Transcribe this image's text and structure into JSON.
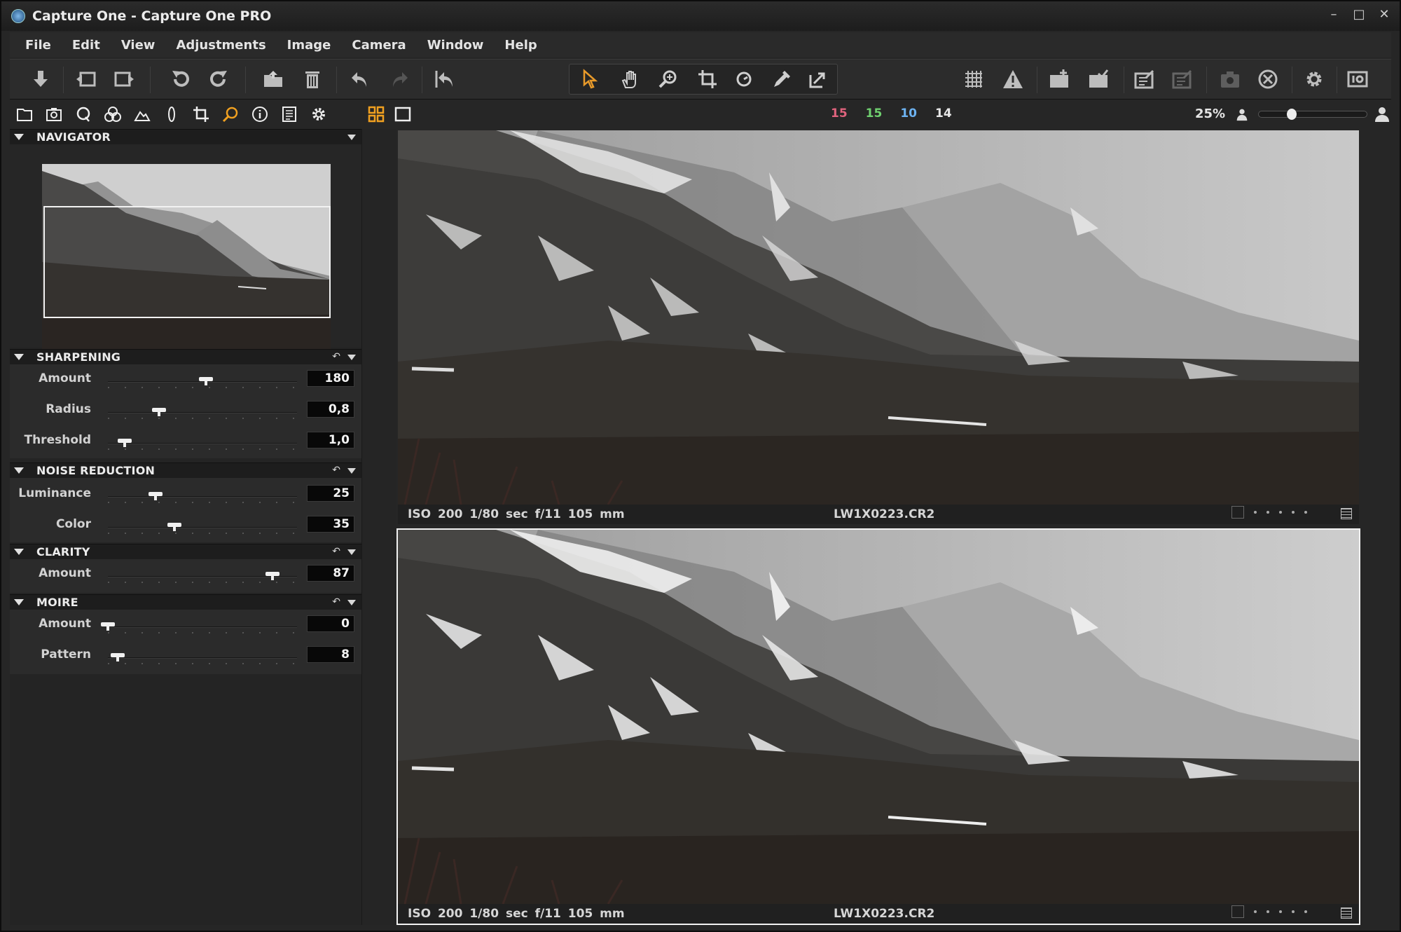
{
  "window": {
    "title": "Capture One - Capture One PRO"
  },
  "menu": [
    "File",
    "Edit",
    "View",
    "Adjustments",
    "Image",
    "Camera",
    "Window",
    "Help"
  ],
  "toolbar": {
    "left": [
      "import-icon",
      "move-left-icon",
      "move-right-icon",
      "rotate-left-icon",
      "rotate-right-icon",
      "open-folder-icon",
      "trash-icon",
      "undo-icon",
      "redo-icon",
      "reset-icon"
    ],
    "cursor_tools": [
      "select-cursor-icon",
      "pan-hand-icon",
      "zoom-icon",
      "crop-icon",
      "rotate-tool-icon",
      "picker-icon",
      "copy-apply-icon"
    ],
    "right": [
      "grid-icon",
      "exposure-warning-icon",
      "new-variant-icon",
      "clone-variant-icon",
      "process-icon",
      "batch-icon",
      "camera-icon",
      "cancel-icon",
      "preferences-icon",
      "info-icon"
    ]
  },
  "tool_tabs": [
    "library-icon",
    "capture-icon",
    "quick-icon",
    "color-icon",
    "exposure-icon",
    "lens-icon",
    "composition-icon",
    "details-icon",
    "metadata-icon",
    "output-icon",
    "settings-icon"
  ],
  "viewer_header": {
    "counts": [
      {
        "value": "15",
        "color": "#e0637d"
      },
      {
        "value": "15",
        "color": "#6fd06f"
      },
      {
        "value": "10",
        "color": "#6db3f2"
      },
      {
        "value": "14",
        "color": "#e8e8e8"
      }
    ],
    "zoom": "25%"
  },
  "navigator": {
    "title": "NAVIGATOR"
  },
  "sharpening": {
    "title": "SHARPENING",
    "rows": [
      {
        "label": "Amount",
        "value": "180",
        "level": 0.52
      },
      {
        "label": "Radius",
        "value": "0,8",
        "level": 0.27
      },
      {
        "label": "Threshold",
        "value": "1,0",
        "level": 0.09
      }
    ]
  },
  "noise_reduction": {
    "title": "NOISE REDUCTION",
    "rows": [
      {
        "label": "Luminance",
        "value": "25",
        "level": 0.25
      },
      {
        "label": "Color",
        "value": "35",
        "level": 0.35
      }
    ]
  },
  "clarity": {
    "title": "CLARITY",
    "rows": [
      {
        "label": "Amount",
        "value": "87",
        "level": 0.87
      }
    ]
  },
  "moire": {
    "title": "MOIRE",
    "rows": [
      {
        "label": "Amount",
        "value": "0",
        "level": 0.0
      },
      {
        "label": "Pattern",
        "value": "8",
        "level": 0.05
      }
    ]
  },
  "images": [
    {
      "meta": "ISO 200  1/80 sec  f/11  105 mm",
      "filename": "LW1X0223.CR2"
    },
    {
      "meta": "ISO 200  1/80 sec  f/11  105 mm",
      "filename": "LW1X0223.CR2"
    }
  ]
}
